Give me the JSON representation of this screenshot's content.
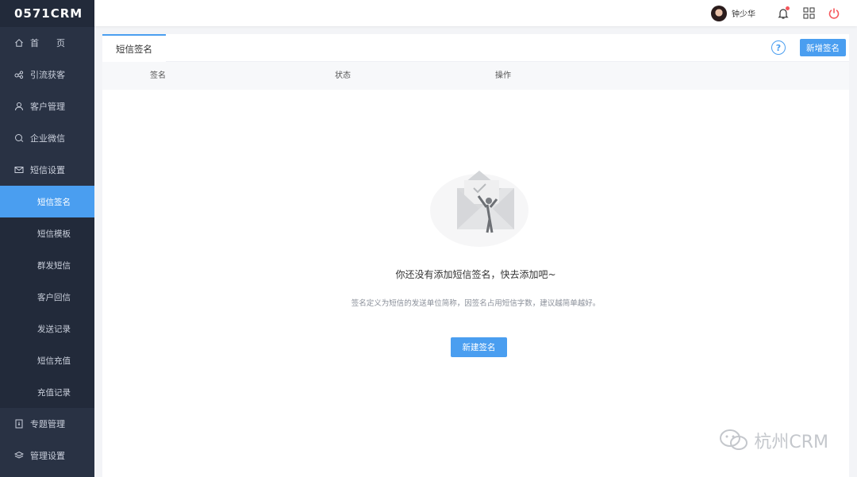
{
  "app": {
    "logo": "0571CRM"
  },
  "sidebar": {
    "items": [
      {
        "label": "首　　页",
        "icon": "home-icon"
      },
      {
        "label": "引流获客",
        "icon": "share-icon"
      },
      {
        "label": "客户管理",
        "icon": "user-icon"
      },
      {
        "label": "企业微信",
        "icon": "chat-icon"
      },
      {
        "label": "短信设置",
        "icon": "mail-icon"
      }
    ],
    "sms_sub": [
      {
        "label": "短信签名",
        "active": true
      },
      {
        "label": "短信模板"
      },
      {
        "label": "群发短信"
      },
      {
        "label": "客户回信"
      },
      {
        "label": "发送记录"
      },
      {
        "label": "短信充值"
      },
      {
        "label": "充值记录"
      }
    ],
    "items_after": [
      {
        "label": "专题管理",
        "icon": "topic-icon"
      },
      {
        "label": "管理设置",
        "icon": "layers-icon"
      }
    ]
  },
  "topbar": {
    "username": "钟少华",
    "has_notification": true
  },
  "tabs": [
    {
      "label": "短信签名",
      "active": true
    }
  ],
  "toolbar": {
    "help": "?",
    "add_signature": "新增签名"
  },
  "table": {
    "columns": [
      "签名",
      "状态",
      "操作"
    ]
  },
  "empty_state": {
    "title": "你还没有添加短信签名，快去添加吧~",
    "description": "签名定义为短信的发送单位简称，因签名占用短信字数，建议越简单越好。",
    "button": "新建签名"
  },
  "watermark": {
    "text": "杭州CRM"
  },
  "colors": {
    "sidebar_bg": "#293244",
    "accent": "#4a9ef0",
    "power": "#f5565b"
  }
}
